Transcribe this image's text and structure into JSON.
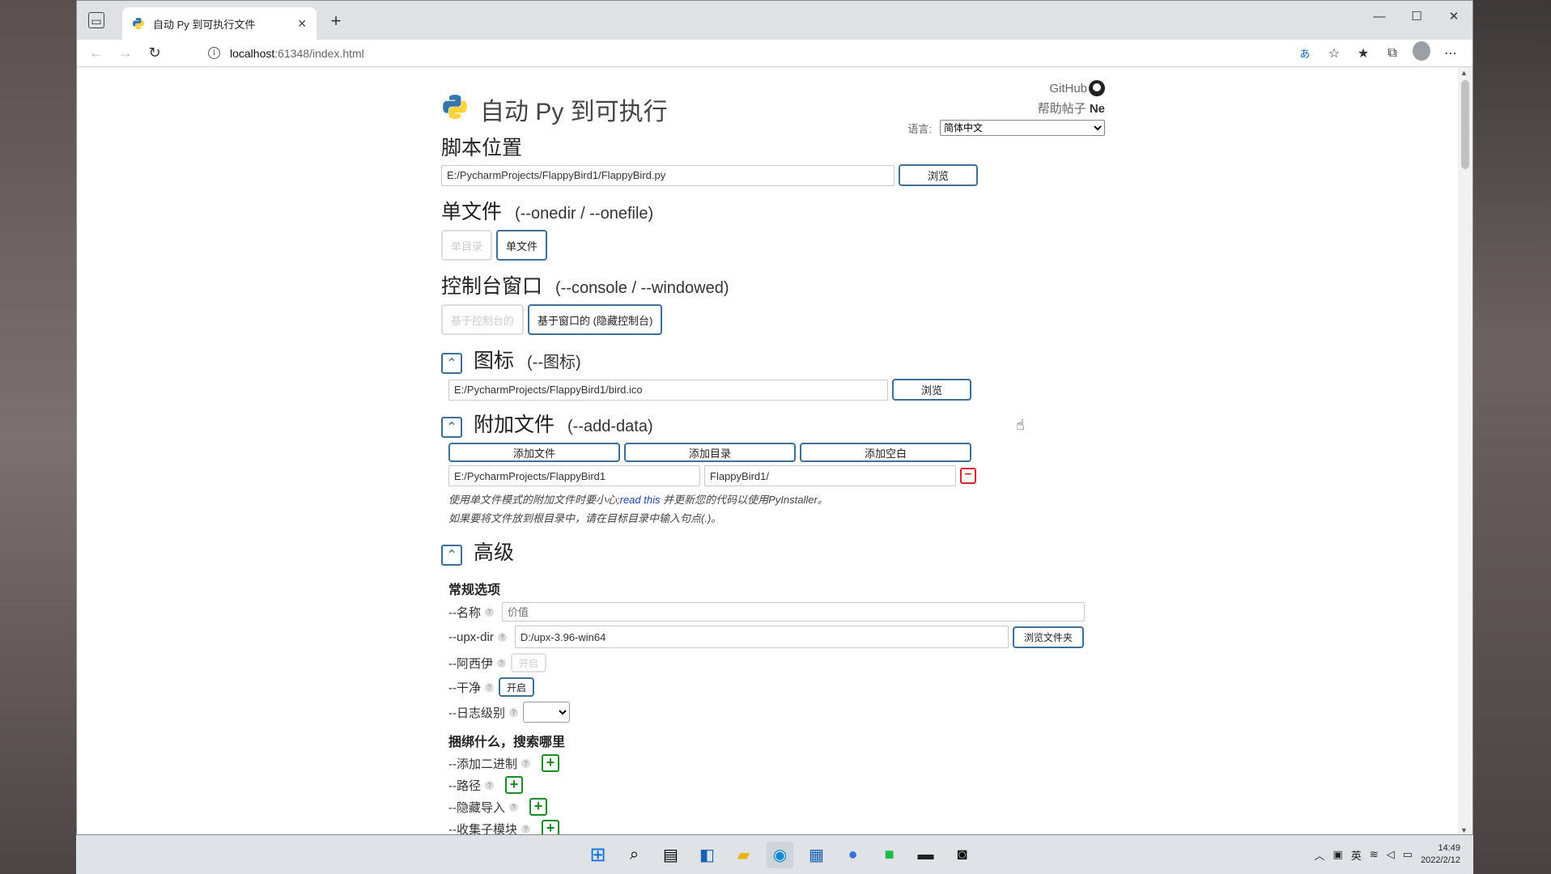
{
  "browser": {
    "tab_title": "自动 Py 到可执行文件",
    "url_host": "localhost",
    "url_rest": ":61348/index.html"
  },
  "header": {
    "title": "自动 Py 到可执行",
    "github": "GitHub",
    "help_prefix": "帮助帖子",
    "help_link": "Ne",
    "language_label": "语言:",
    "language_value": "简体中文"
  },
  "script_location": {
    "heading": "脚本位置",
    "path": "E:/PycharmProjects/FlappyBird1/FlappyBird.py",
    "browse": "浏览"
  },
  "onefile": {
    "heading": "单文件",
    "sub": "(--onedir / --onefile)",
    "option_dir": "单目录",
    "option_file": "单文件"
  },
  "console": {
    "heading": "控制台窗口",
    "sub": "(--console / --windowed)",
    "option_console": "基于控制台的",
    "option_window": "基于窗口的 (隐藏控制台)"
  },
  "icon": {
    "heading": "图标",
    "sub": "(--图标)",
    "path": "E:/PycharmProjects/FlappyBird1/bird.ico",
    "browse": "浏览"
  },
  "add_data": {
    "heading": "附加文件",
    "sub": "(--add-data)",
    "add_file": "添加文件",
    "add_dir": "添加目录",
    "add_blank": "添加空白",
    "source": "E:/PycharmProjects/FlappyBird1",
    "dest": "FlappyBird1/",
    "note1_prefix": "使用单文件模式的附加文件时要小心;",
    "note1_link": "read this",
    "note1_suffix": " 并更新您的代码以使用PyInstaller。",
    "note2": "如果要将文件放到根目录中，请在目标目录中输入句点(.)。"
  },
  "advanced": {
    "heading": "高级",
    "general_title": "常规选项",
    "name_label": "--名称",
    "name_placeholder": "价值",
    "upx_label": "--upx-dir",
    "upx_value": "D:/upx-3.96-win64",
    "upx_browse": "浏览文件夹",
    "ascii_label": "--阿西伊",
    "ascii_btn": "开启",
    "clean_label": "--干净",
    "clean_btn": "开启",
    "log_label": "--日志级别",
    "bundle_title": "捆绑什么，搜索哪里",
    "add_binary_label": "--添加二进制",
    "paths_label": "--路径",
    "hidden_import_label": "--隐藏导入",
    "collect_label": "--收集子模块"
  },
  "tray": {
    "ime": "英",
    "time": "14:49",
    "date": "2022/2/12"
  }
}
